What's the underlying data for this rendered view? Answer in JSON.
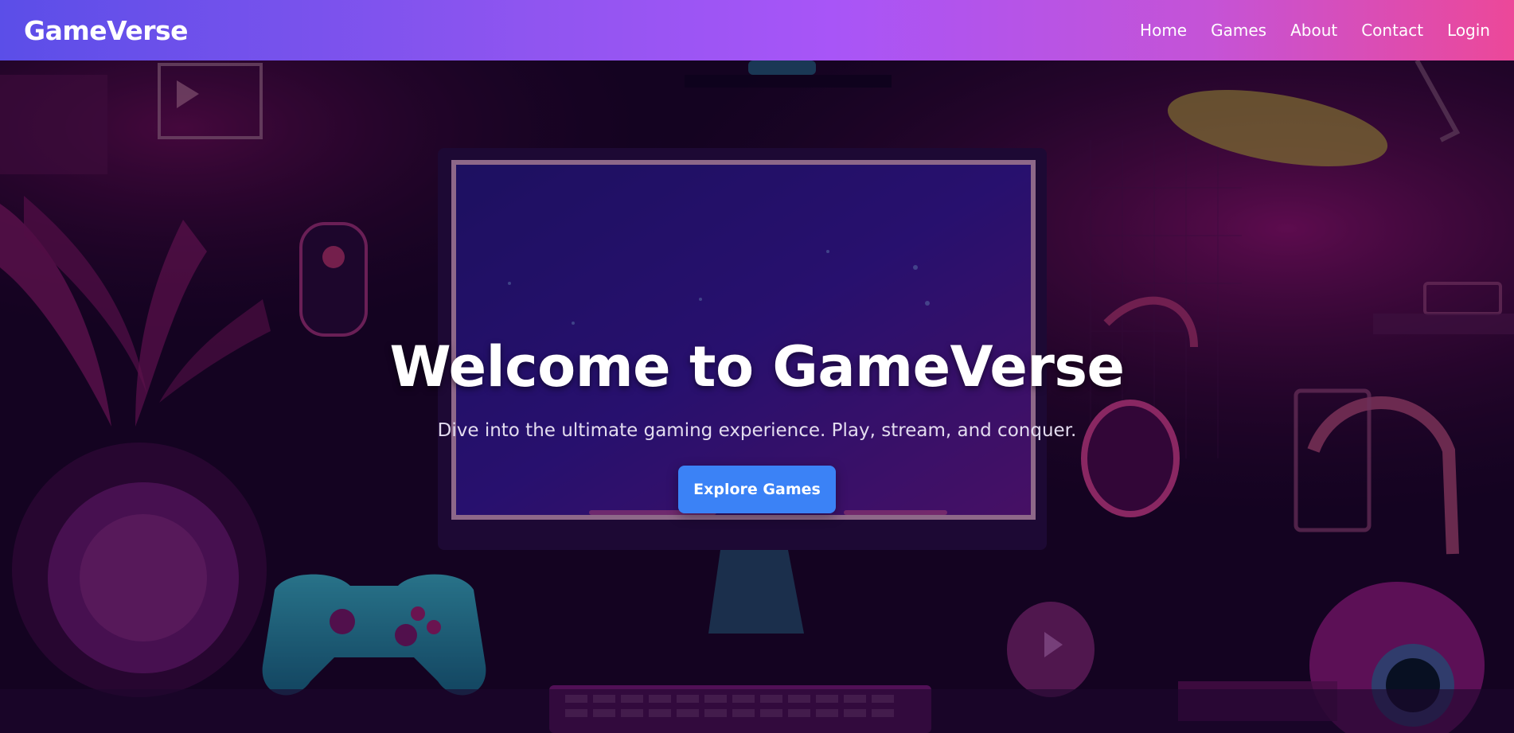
{
  "brand": {
    "name": "GameVerse"
  },
  "nav": {
    "items": [
      {
        "label": "Home"
      },
      {
        "label": "Games"
      },
      {
        "label": "About"
      },
      {
        "label": "Contact"
      },
      {
        "label": "Login"
      }
    ]
  },
  "hero": {
    "title": "Welcome to GameVerse",
    "subtitle": "Dive into the ultimate gaming experience. Play, stream, and conquer.",
    "cta_label": "Explore Games"
  },
  "colors": {
    "nav_gradient_start": "#5b4ee8",
    "nav_gradient_end": "#ec4899",
    "cta_background": "#3b82f6"
  }
}
